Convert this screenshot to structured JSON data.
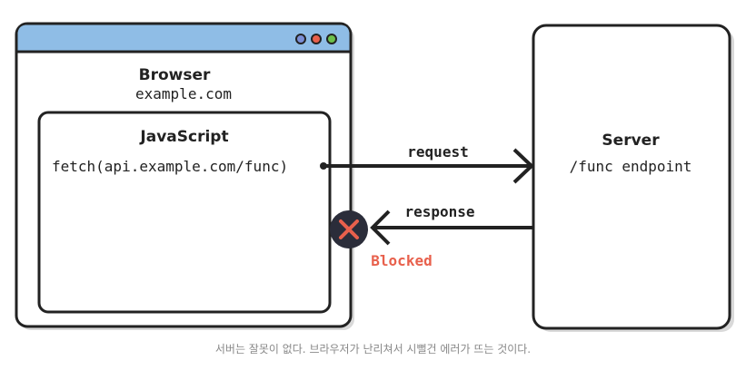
{
  "browser": {
    "title": "Browser",
    "origin": "example.com",
    "title_bar_color": "#8fbde6",
    "window_controls": [
      {
        "name": "window-dot-icon",
        "color": "#7b8fd6"
      },
      {
        "name": "window-dot-icon",
        "color": "#e8604c"
      },
      {
        "name": "window-dot-icon",
        "color": "#6cc04a"
      }
    ]
  },
  "script": {
    "title": "JavaScript",
    "code": "fetch(api.example.com/func)"
  },
  "server": {
    "title": "Server",
    "endpoint": "/func endpoint"
  },
  "arrows": {
    "request_label": "request",
    "response_label": "response"
  },
  "status": {
    "blocked_label": "Blocked",
    "blocked_color": "#e8604c",
    "icon": "close-icon"
  },
  "caption": "서버는 잘못이 없다. 브라우저가 난리쳐서 시뻘건 에러가 뜨는 것이다."
}
